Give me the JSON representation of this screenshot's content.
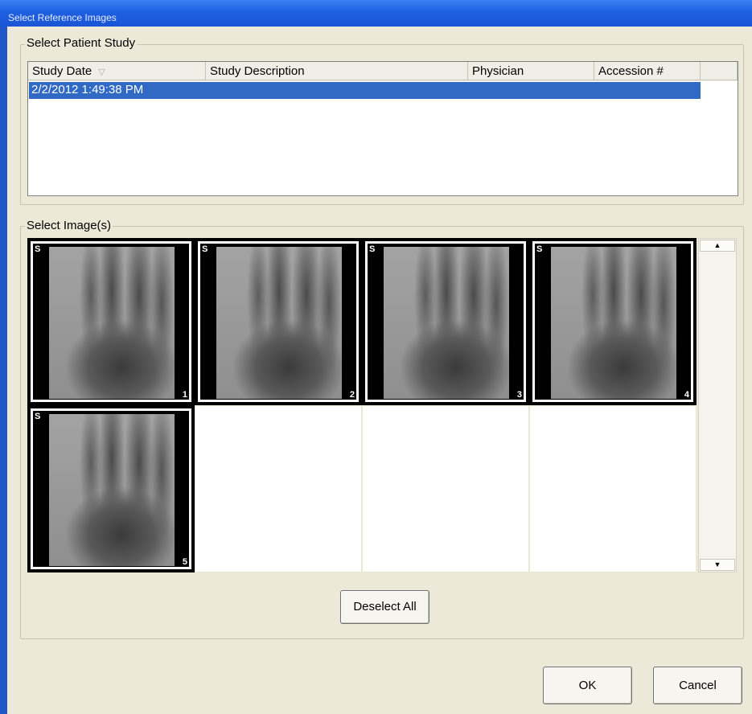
{
  "window": {
    "title": "Select Reference Images"
  },
  "study_group": {
    "label": "Select Patient Study",
    "columns": [
      {
        "label": "Study Date",
        "sort_icon": "sort-down-icon"
      },
      {
        "label": "Study Description"
      },
      {
        "label": "Physician"
      },
      {
        "label": "Accession #"
      }
    ],
    "rows": [
      {
        "study_date": "2/2/2012 1:49:38 PM",
        "selected": true
      }
    ]
  },
  "image_group": {
    "label": "Select Image(s)",
    "images": [
      {
        "orientation": "S",
        "number": "1",
        "selected": true
      },
      {
        "orientation": "S",
        "number": "2",
        "selected": true
      },
      {
        "orientation": "S",
        "number": "3",
        "selected": true
      },
      {
        "orientation": "S",
        "number": "4",
        "selected": true
      },
      {
        "orientation": "S",
        "number": "5",
        "selected": true
      }
    ],
    "deselect_all_label": "Deselect All"
  },
  "buttons": {
    "ok": "OK",
    "cancel": "Cancel"
  }
}
